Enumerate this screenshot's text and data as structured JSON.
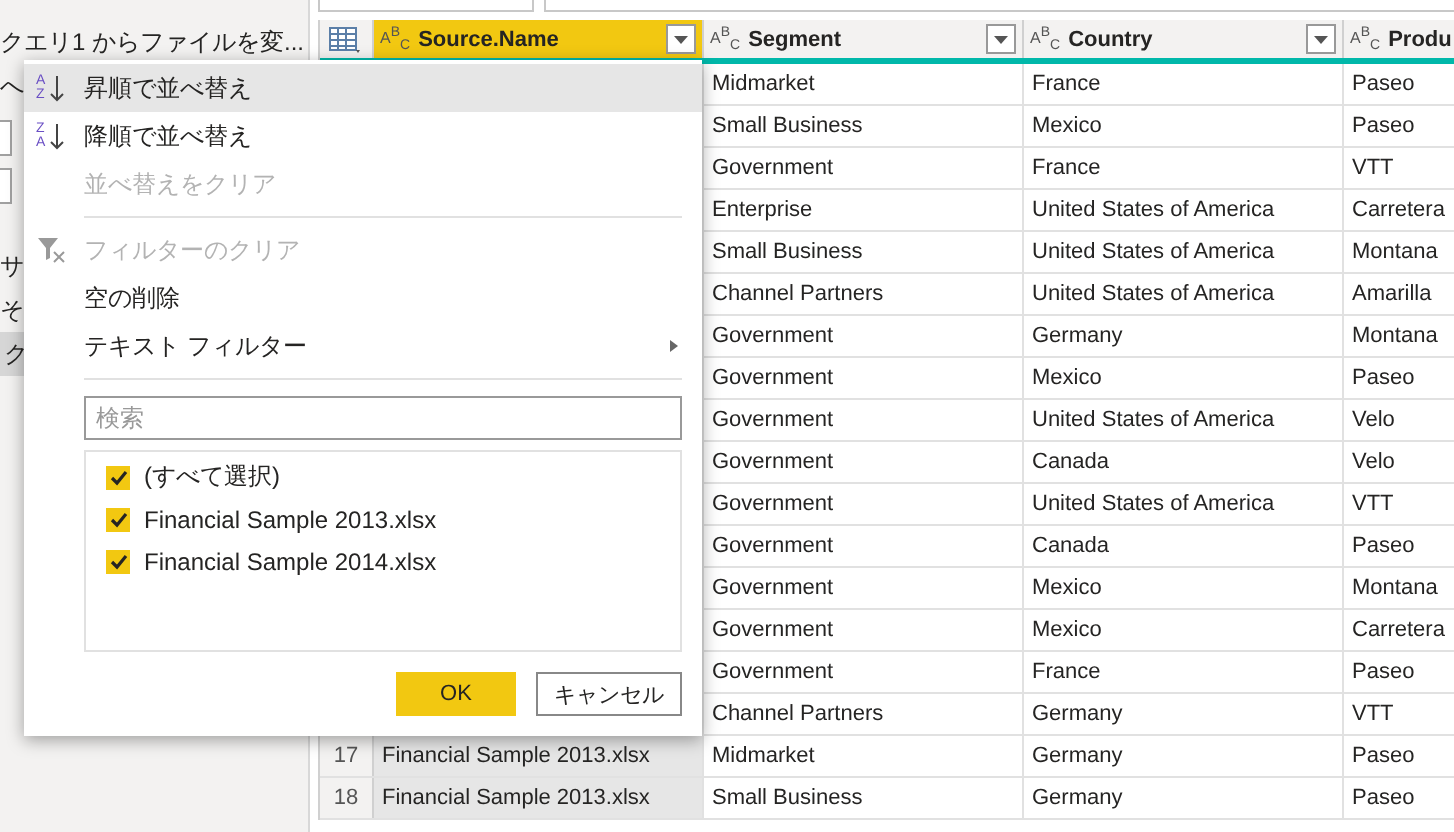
{
  "sidebar": {
    "items": [
      {
        "label": "クエリ1 からファイルを変...",
        "selected": false
      },
      {
        "label": "へ",
        "selected": false
      },
      {
        "label": "サ",
        "selected": false
      },
      {
        "label": "そ",
        "selected": false
      },
      {
        "label": "ク",
        "selected": true
      }
    ]
  },
  "table": {
    "columns": [
      {
        "type": "A$^{B}$$_{C}$",
        "label": "Source.Name",
        "selected": true
      },
      {
        "type": "A$^{B}$$_{C}$",
        "label": "Segment",
        "selected": false
      },
      {
        "type": "A$^{B}$$_{C}$",
        "label": "Country",
        "selected": false
      },
      {
        "type": "A$^{B}$$_{C}$",
        "label": "Produ",
        "selected": false
      }
    ],
    "rows": [
      {
        "segment": "Midmarket",
        "country": "France",
        "product": "Paseo"
      },
      {
        "segment": "Small Business",
        "country": "Mexico",
        "product": "Paseo"
      },
      {
        "segment": "Government",
        "country": "France",
        "product": "VTT"
      },
      {
        "segment": "Enterprise",
        "country": "United States of America",
        "product": "Carretera"
      },
      {
        "segment": "Small Business",
        "country": "United States of America",
        "product": "Montana"
      },
      {
        "segment": "Channel Partners",
        "country": "United States of America",
        "product": "Amarilla"
      },
      {
        "segment": "Government",
        "country": "Germany",
        "product": "Montana"
      },
      {
        "segment": "Government",
        "country": "Mexico",
        "product": "Paseo"
      },
      {
        "segment": "Government",
        "country": "United States of America",
        "product": "Velo"
      },
      {
        "segment": "Government",
        "country": "Canada",
        "product": "Velo"
      },
      {
        "segment": "Government",
        "country": "United States of America",
        "product": "VTT"
      },
      {
        "segment": "Government",
        "country": "Canada",
        "product": "Paseo"
      },
      {
        "segment": "Government",
        "country": "Mexico",
        "product": "Montana"
      },
      {
        "segment": "Government",
        "country": "Mexico",
        "product": "Carretera"
      },
      {
        "segment": "Government",
        "country": "France",
        "product": "Paseo"
      },
      {
        "segment": "Channel Partners",
        "country": "Germany",
        "product": "VTT"
      },
      {
        "row_number": "17",
        "source_name": "Financial Sample 2013.xlsx",
        "segment": "Midmarket",
        "country": "Germany",
        "product": "Paseo"
      },
      {
        "row_number": "18",
        "source_name": "Financial Sample 2013.xlsx",
        "segment": "Small Business",
        "country": "Germany",
        "product": "Paseo"
      }
    ]
  },
  "menu": {
    "items": [
      {
        "kind": "sort",
        "icon_letters": [
          "A",
          "Z"
        ],
        "label": "昇順で並べ替え",
        "highlighted": true,
        "disabled": false
      },
      {
        "kind": "sort",
        "icon_letters": [
          "Z",
          "A"
        ],
        "label": "降順で並べ替え",
        "highlighted": false,
        "disabled": false
      },
      {
        "kind": "plain",
        "label": "並べ替えをクリア",
        "highlighted": false,
        "disabled": true
      },
      {
        "kind": "divider"
      },
      {
        "kind": "filter",
        "label": "フィルターのクリア",
        "highlighted": false,
        "disabled": true
      },
      {
        "kind": "plain",
        "label": "空の削除",
        "highlighted": false,
        "disabled": false
      },
      {
        "kind": "submenu",
        "label": "テキスト フィルター",
        "highlighted": false,
        "disabled": false
      },
      {
        "kind": "divider"
      }
    ],
    "search": {
      "placeholder": "検索"
    },
    "checklist": [
      {
        "label": "(すべて選択)",
        "checked": true
      },
      {
        "label": "Financial Sample 2013.xlsx",
        "checked": true
      },
      {
        "label": "Financial Sample 2014.xlsx",
        "checked": true
      }
    ],
    "buttons": [
      {
        "label": "OK",
        "kind": "primary"
      },
      {
        "label": "キャンセル",
        "kind": "secondary"
      }
    ]
  }
}
